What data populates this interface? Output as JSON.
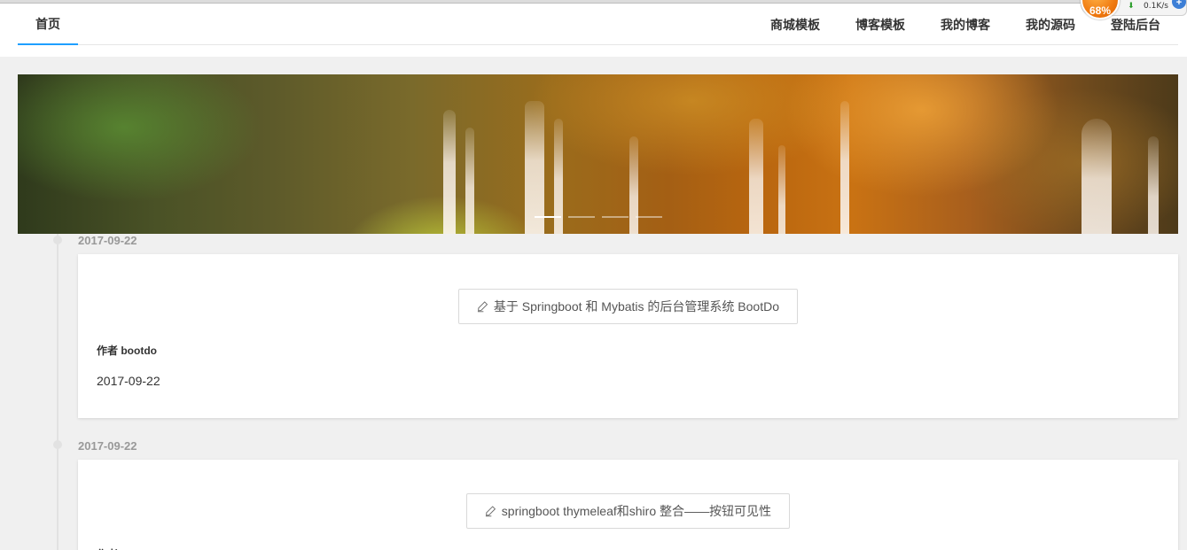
{
  "nav": {
    "home": "首页",
    "links": [
      "商城模板",
      "博客模板",
      "我的博客",
      "我的源码",
      "登陆后台"
    ]
  },
  "speed_widget": {
    "percent": "68%",
    "rate": "0.1K/s"
  },
  "carousel": {
    "slide_count": 4,
    "active_index": 0
  },
  "posts": [
    {
      "date": "2017-09-22",
      "title": "基于 Springboot 和 Mybatis 的后台管理系统 BootDo",
      "author": "作者 bootdo",
      "card_date": "2017-09-22"
    },
    {
      "date": "2017-09-22",
      "title": "springboot thymeleaf和shiro 整合——按钮可见性",
      "author": "作者"
    }
  ],
  "colors": {
    "active_tab": "#1e9fff",
    "page_bg": "#f0f0f0"
  }
}
